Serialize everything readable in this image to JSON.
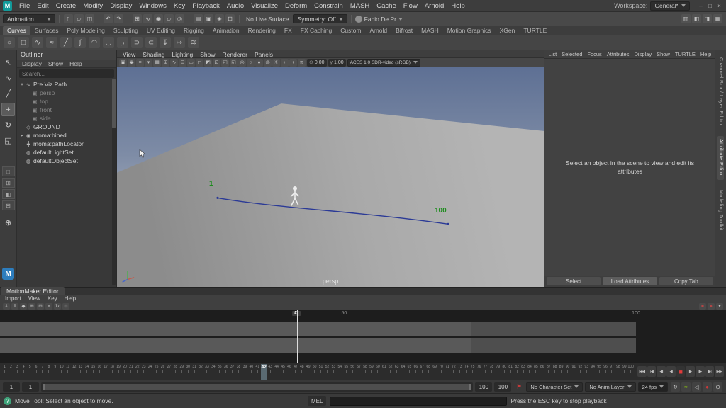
{
  "colors": {
    "accent_blue": "#2d7dbd",
    "sky_top": "#5e7094",
    "sky_bottom": "#b6bcc6",
    "ground_gray": "#a9a9a9",
    "motion_path_blue": "#2b3a96",
    "path_label_green": "#1e8c1e",
    "stop_red": "#e23b3b",
    "timeline_band_gray": "#595959"
  },
  "window_controls": [
    {
      "name": "minimize-button",
      "glyph": "–"
    },
    {
      "name": "maximize-button",
      "glyph": "□"
    },
    {
      "name": "close-button",
      "glyph": "×"
    }
  ],
  "menubar": {
    "logo": "M",
    "items": [
      "File",
      "Edit",
      "Create",
      "Modify",
      "Display",
      "Windows",
      "Key",
      "Playback",
      "Audio",
      "Visualize",
      "Deform",
      "Constrain",
      "MASH",
      "Cache",
      "Flow",
      "Arnold",
      "Help"
    ],
    "workspace_label": "Workspace:",
    "workspace_value": "General*"
  },
  "statusline": {
    "menuset": "Animation",
    "file_icons": [
      {
        "name": "new-scene-icon",
        "glyph": "▯"
      },
      {
        "name": "open-scene-icon",
        "glyph": "▱"
      },
      {
        "name": "save-scene-icon",
        "glyph": "◫"
      }
    ],
    "history_icons": [
      {
        "name": "undo-icon",
        "glyph": "↶"
      },
      {
        "name": "redo-icon",
        "glyph": "↷"
      }
    ],
    "snap_icons": [
      {
        "name": "snap-to-grid-icon",
        "glyph": "⊞"
      },
      {
        "name": "snap-to-curve-icon",
        "glyph": "∿"
      },
      {
        "name": "snap-to-point-icon",
        "glyph": "◉"
      },
      {
        "name": "snap-to-plane-icon",
        "glyph": "▱"
      },
      {
        "name": "make-live-icon",
        "glyph": "◎"
      }
    ],
    "render_icons": [
      {
        "name": "construction-history-icon",
        "glyph": "▤"
      },
      {
        "name": "render-view-icon",
        "glyph": "▣"
      },
      {
        "name": "ipr-render-icon",
        "glyph": "◈"
      },
      {
        "name": "render-settings-icon",
        "glyph": "⊡"
      }
    ],
    "live_surface_label": "No Live Surface",
    "symmetry_label": "Symmetry: Off",
    "account_name": "Fabio De Pr",
    "right_icons": [
      {
        "name": "modeling-toolkit-toggle-icon",
        "glyph": "▥"
      },
      {
        "name": "tool-settings-toggle-icon",
        "glyph": "◧"
      },
      {
        "name": "attribute-editor-toggle-icon",
        "glyph": "◨"
      },
      {
        "name": "channel-box-toggle-icon",
        "glyph": "▦"
      }
    ]
  },
  "shelf": {
    "active_tab": "Curves",
    "tabs": [
      {
        "label": "Curves",
        "active": true
      },
      {
        "label": "Surfaces"
      },
      {
        "label": "Poly Modeling"
      },
      {
        "label": "Sculpting"
      },
      {
        "label": "UV Editing"
      },
      {
        "label": "Rigging"
      },
      {
        "label": "Animation"
      },
      {
        "label": "Rendering"
      },
      {
        "label": "FX"
      },
      {
        "label": "FX Caching"
      },
      {
        "label": "Custom"
      },
      {
        "label": "Arnold"
      },
      {
        "label": "Bifrost"
      },
      {
        "label": "MASH"
      },
      {
        "label": "Motion Graphics"
      },
      {
        "label": "XGen"
      },
      {
        "label": "TURTLE"
      }
    ],
    "icons": [
      {
        "name": "nurbs-circle-icon",
        "glyph": "○"
      },
      {
        "name": "nurbs-square-icon",
        "glyph": "□"
      },
      {
        "name": "cv-curve-icon",
        "glyph": "∿"
      },
      {
        "name": "ep-curve-icon",
        "glyph": "≈"
      },
      {
        "name": "pencil-curve-icon",
        "glyph": "╱"
      },
      {
        "name": "bezier-curve-icon",
        "glyph": "∫"
      },
      {
        "name": "three-point-arc-icon",
        "glyph": "◠"
      },
      {
        "name": "two-point-arc-icon",
        "glyph": "◡"
      },
      {
        "name": "curve-fillet-icon",
        "glyph": "◞"
      },
      {
        "name": "attach-curves-icon",
        "glyph": "⊃"
      },
      {
        "name": "detach-curves-icon",
        "glyph": "⊂"
      },
      {
        "name": "insert-knot-icon",
        "glyph": "↧"
      },
      {
        "name": "extend-curve-icon",
        "glyph": "↦"
      },
      {
        "name": "offset-curve-icon",
        "glyph": "≋"
      }
    ]
  },
  "toolbox": {
    "tools": [
      {
        "name": "select-tool-button",
        "glyph": "↖"
      },
      {
        "name": "lasso-tool-button",
        "glyph": "∿"
      },
      {
        "name": "paint-select-tool-button",
        "glyph": "╱"
      },
      {
        "name": "move-tool-button",
        "glyph": "+",
        "active": true
      },
      {
        "name": "rotate-tool-button",
        "glyph": "↻"
      },
      {
        "name": "scale-tool-button",
        "glyph": "◱"
      }
    ],
    "layouts": [
      {
        "name": "single-pane-layout-button",
        "glyph": "□"
      },
      {
        "name": "four-pane-layout-button",
        "glyph": "⊞"
      },
      {
        "name": "persp-outliner-layout-button",
        "glyph": "◧"
      },
      {
        "name": "persp-graph-layout-button",
        "glyph": "⊟"
      }
    ],
    "zoom_glyph": "⊕",
    "motionmaker_label": "M"
  },
  "outliner": {
    "title": "Outliner",
    "menus": [
      "Display",
      "Show",
      "Help"
    ],
    "search_placeholder": "Search...",
    "items": [
      {
        "label": "Pre Viz Path",
        "expander": "▾",
        "icon": "motion-path-icon",
        "glyph": "∿",
        "depth": 0
      },
      {
        "label": "persp",
        "expander": "",
        "icon": "camera-icon",
        "glyph": "▣",
        "depth": 1,
        "muted": true
      },
      {
        "label": "top",
        "expander": "",
        "icon": "camera-icon",
        "glyph": "▣",
        "depth": 1,
        "muted": true
      },
      {
        "label": "front",
        "expander": "",
        "icon": "camera-icon",
        "glyph": "▣",
        "depth": 1,
        "muted": true
      },
      {
        "label": "side",
        "expander": "",
        "icon": "camera-icon",
        "glyph": "▣",
        "depth": 1,
        "muted": true
      },
      {
        "label": "GROUND",
        "expander": "",
        "icon": "mesh-icon",
        "glyph": "◇",
        "depth": 0
      },
      {
        "label": "moma:biped",
        "expander": "▸",
        "icon": "reference-node-icon",
        "glyph": "◉",
        "depth": 0
      },
      {
        "label": "moma:pathLocator",
        "expander": "",
        "icon": "locator-icon",
        "glyph": "╋",
        "depth": 0
      },
      {
        "label": "defaultLightSet",
        "expander": "",
        "icon": "set-icon",
        "glyph": "◍",
        "depth": 0
      },
      {
        "label": "defaultObjectSet",
        "expander": "",
        "icon": "set-icon",
        "glyph": "◍",
        "depth": 0
      }
    ]
  },
  "viewport": {
    "menus": [
      "View",
      "Shading",
      "Lighting",
      "Show",
      "Renderer",
      "Panels"
    ],
    "toolbar_icons": [
      {
        "name": "select-camera-icon",
        "glyph": "▣"
      },
      {
        "name": "lock-camera-icon",
        "glyph": "◉"
      },
      {
        "name": "camera-attributes-icon",
        "glyph": "≡"
      },
      {
        "name": "bookmarks-icon",
        "glyph": "▾"
      },
      {
        "name": "image-plane-icon",
        "glyph": "▦"
      },
      {
        "name": "2d-pan-zoom-icon",
        "glyph": "⊞"
      },
      {
        "name": "grease-pencil-icon",
        "glyph": "∿"
      },
      {
        "name": "grid-icon",
        "glyph": "⊟"
      },
      {
        "name": "film-gate-icon",
        "glyph": "▭"
      },
      {
        "name": "resolution-gate-icon",
        "glyph": "◻"
      },
      {
        "name": "gate-mask-icon",
        "glyph": "◩"
      },
      {
        "name": "field-chart-icon",
        "glyph": "⊡"
      },
      {
        "name": "safe-action-icon",
        "glyph": "◰"
      },
      {
        "name": "safe-title-icon",
        "glyph": "◱"
      },
      {
        "name": "isolate-select-icon",
        "glyph": "◎"
      },
      {
        "name": "wireframe-icon",
        "glyph": "○"
      },
      {
        "name": "shaded-icon",
        "glyph": "●"
      },
      {
        "name": "textured-icon",
        "glyph": "◍"
      },
      {
        "name": "lights-icon",
        "glyph": "☀"
      },
      {
        "name": "shadows-icon",
        "glyph": "◐"
      },
      {
        "name": "occlusion-icon",
        "glyph": "◑"
      },
      {
        "name": "motion-blur-icon",
        "glyph": "≋"
      }
    ],
    "exposure_icon": "⊙",
    "exposure": "0.00",
    "gamma_icon": "γ",
    "gamma": "1.00",
    "colorspace": "ACES 1.0 SDR-video (sRGB)",
    "camera_label": "persp",
    "path_start_label": "1",
    "path_end_label": "100"
  },
  "attribute_editor": {
    "menus": [
      "List",
      "Selected",
      "Focus",
      "Attributes",
      "Display",
      "Show",
      "TURTLE",
      "Help"
    ],
    "empty_message": "Select an object in the scene to view and edit its attributes",
    "buttons": [
      {
        "label": "Select"
      },
      {
        "label": "Load Attributes",
        "active": true
      },
      {
        "label": "Copy Tab"
      }
    ]
  },
  "side_tabs": [
    {
      "label": "Channel Box / Layer Editor"
    },
    {
      "label": "Attribute Editor",
      "active": true
    },
    {
      "label": "Modeling Toolkit"
    }
  ],
  "motionmaker": {
    "tab_label": "MotionMaker Editor",
    "menus": [
      "Import",
      "View",
      "Key",
      "Help"
    ],
    "icons": [
      {
        "name": "import-clip-icon",
        "glyph": "⇓"
      },
      {
        "name": "export-clip-icon",
        "glyph": "⇑"
      },
      {
        "name": "set-key-icon",
        "glyph": "◆"
      },
      {
        "name": "copy-icon",
        "glyph": "⊞"
      },
      {
        "name": "paste-icon",
        "glyph": "⊟"
      },
      {
        "name": "cut-icon",
        "glyph": "×"
      },
      {
        "name": "loop-icon",
        "glyph": "↻"
      },
      {
        "name": "options-icon",
        "glyph": "⊙"
      }
    ],
    "right_icons": [
      {
        "name": "mute-track-icon",
        "glyph": "■",
        "color": "#b24646"
      },
      {
        "name": "solo-track-icon",
        "glyph": "●",
        "color": "#b24646"
      },
      {
        "name": "panel-menu-icon",
        "glyph": "▾"
      }
    ],
    "ruler_marks": [
      {
        "label": "42",
        "pct": 40.8,
        "active": true
      },
      {
        "label": "50",
        "pct": 47.4
      },
      {
        "label": "100",
        "pct": 87.6
      }
    ],
    "playhead_pct": 40.9
  },
  "timeslider": {
    "start": 1,
    "end": 100,
    "current": 42,
    "playback_buttons": [
      {
        "name": "go-to-start-button",
        "glyph": "|◀◀"
      },
      {
        "name": "step-back-key-button",
        "glyph": "|◀"
      },
      {
        "name": "step-back-frame-button",
        "glyph": "◀|"
      },
      {
        "name": "play-backwards-button",
        "glyph": "◀"
      },
      {
        "name": "stop-button",
        "glyph": "■",
        "active": true
      },
      {
        "name": "play-forwards-button",
        "glyph": "▶"
      },
      {
        "name": "step-forward-frame-button",
        "glyph": "|▶"
      },
      {
        "name": "step-forward-key-button",
        "glyph": "▶|"
      },
      {
        "name": "go-to-end-button",
        "glyph": "▶▶|"
      }
    ]
  },
  "rangeslider": {
    "anim_start": "1",
    "playback_start": "1",
    "playback_end": "100",
    "anim_end": "100",
    "flag_glyph": "⚑",
    "character_set": "No Character Set",
    "anim_layer": "No Anim Layer",
    "fps": "24 fps",
    "right_icons": [
      {
        "name": "loop-playback-icon",
        "glyph": "↻"
      },
      {
        "name": "cached-playback-icon",
        "glyph": "≈",
        "color": "#86b816"
      },
      {
        "name": "mute-audio-icon",
        "glyph": "◁"
      },
      {
        "name": "auto-key-icon",
        "glyph": "●",
        "color": "#cc3a3a"
      },
      {
        "name": "animation-preferences-icon",
        "glyph": "⊙"
      }
    ]
  },
  "helpline": {
    "help_icon_glyph": "?",
    "message": "Move Tool: Select an object to move.",
    "mel_label": "MEL",
    "esc_hint": "Press the ESC key to stop playback"
  }
}
